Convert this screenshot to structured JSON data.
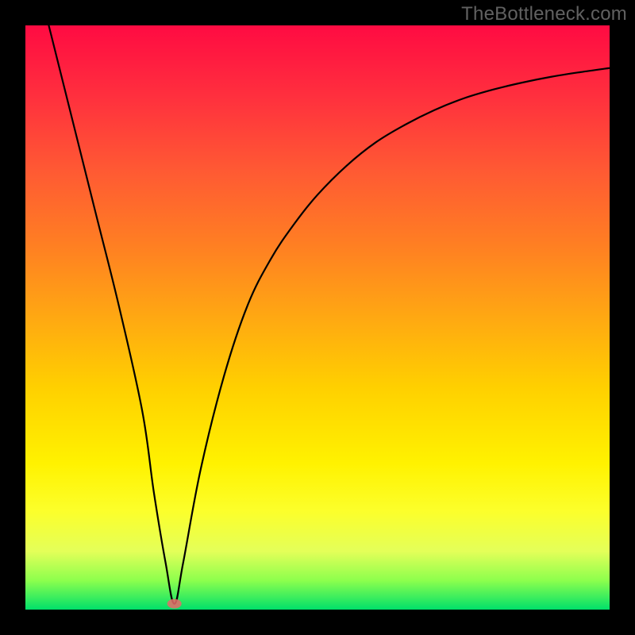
{
  "watermark": "TheBottleneck.com",
  "chart_data": {
    "type": "line",
    "title": "",
    "xlabel": "",
    "ylabel": "",
    "xlim": [
      0,
      100
    ],
    "ylim": [
      0,
      100
    ],
    "series": [
      {
        "name": "bottleneck-curve",
        "x": [
          4,
          8,
          12,
          16,
          20,
          22,
          24,
          25.5,
          27,
          30,
          34,
          38,
          42,
          46,
          50,
          55,
          60,
          65,
          70,
          75,
          80,
          85,
          90,
          95,
          100
        ],
        "values": [
          100,
          84,
          68,
          52,
          34,
          20,
          8,
          1,
          8,
          24,
          40,
          52,
          60,
          66,
          71,
          76,
          80,
          83,
          85.5,
          87.5,
          89,
          90.2,
          91.2,
          92,
          92.7
        ]
      }
    ],
    "annotations": [
      {
        "name": "optimal-point",
        "x": 25.5,
        "y": 1
      }
    ],
    "colors": {
      "gradient_top": "#ff0b42",
      "gradient_bottom": "#00e06a",
      "curve": "#000000",
      "marker": "#e86a6a"
    }
  }
}
